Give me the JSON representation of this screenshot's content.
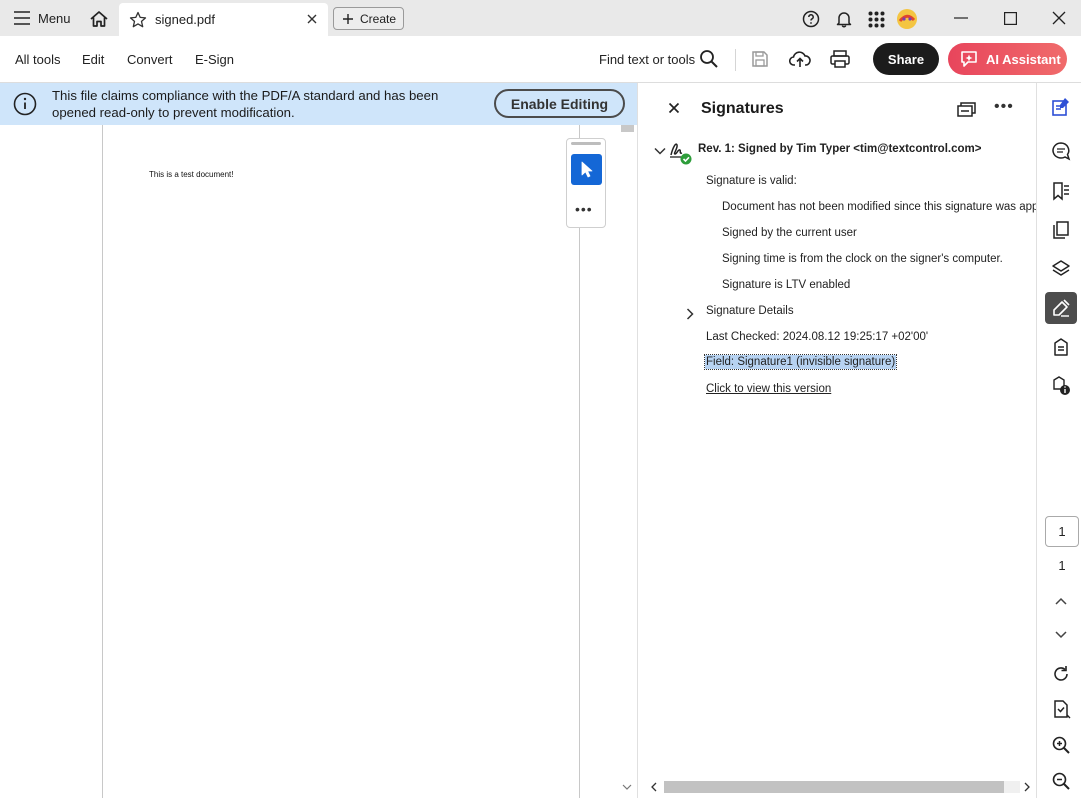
{
  "titlebar": {
    "menu_label": "Menu",
    "tab_name": "signed.pdf",
    "create_label": "Create"
  },
  "toolbar": {
    "items": [
      "All tools",
      "Edit",
      "Convert",
      "E-Sign"
    ],
    "find_label": "Find text or tools",
    "share_label": "Share",
    "ai_label": "AI Assistant"
  },
  "notice": {
    "text": "This file claims compliance with the PDF/A standard and has been opened read-only to prevent modification.",
    "button_label": "Enable Editing"
  },
  "document": {
    "text": "This is a test document!"
  },
  "signatures_panel": {
    "title": "Signatures",
    "revision": "Rev. 1: Signed by Tim Typer <tim@textcontrol.com>",
    "status": "Signature is valid:",
    "details_list": [
      "Document has not been modified since this signature was applied",
      "Signed by the current user",
      "Signing time is from the clock on the signer's computer.",
      "Signature is LTV enabled"
    ],
    "details_label": "Signature Details",
    "last_checked": "Last Checked: 2024.08.12 19:25:17 +02'00'",
    "field": "Field: Signature1 (invisible signature)",
    "view_link": "Click to view this version"
  },
  "page_nav": {
    "current": "1",
    "total": "1"
  },
  "colors": {
    "accent": "#1467d6",
    "notice_bg": "#cfe5fa",
    "ai_gradient_start": "#e8455c",
    "valid_green": "#2d9d3a"
  }
}
